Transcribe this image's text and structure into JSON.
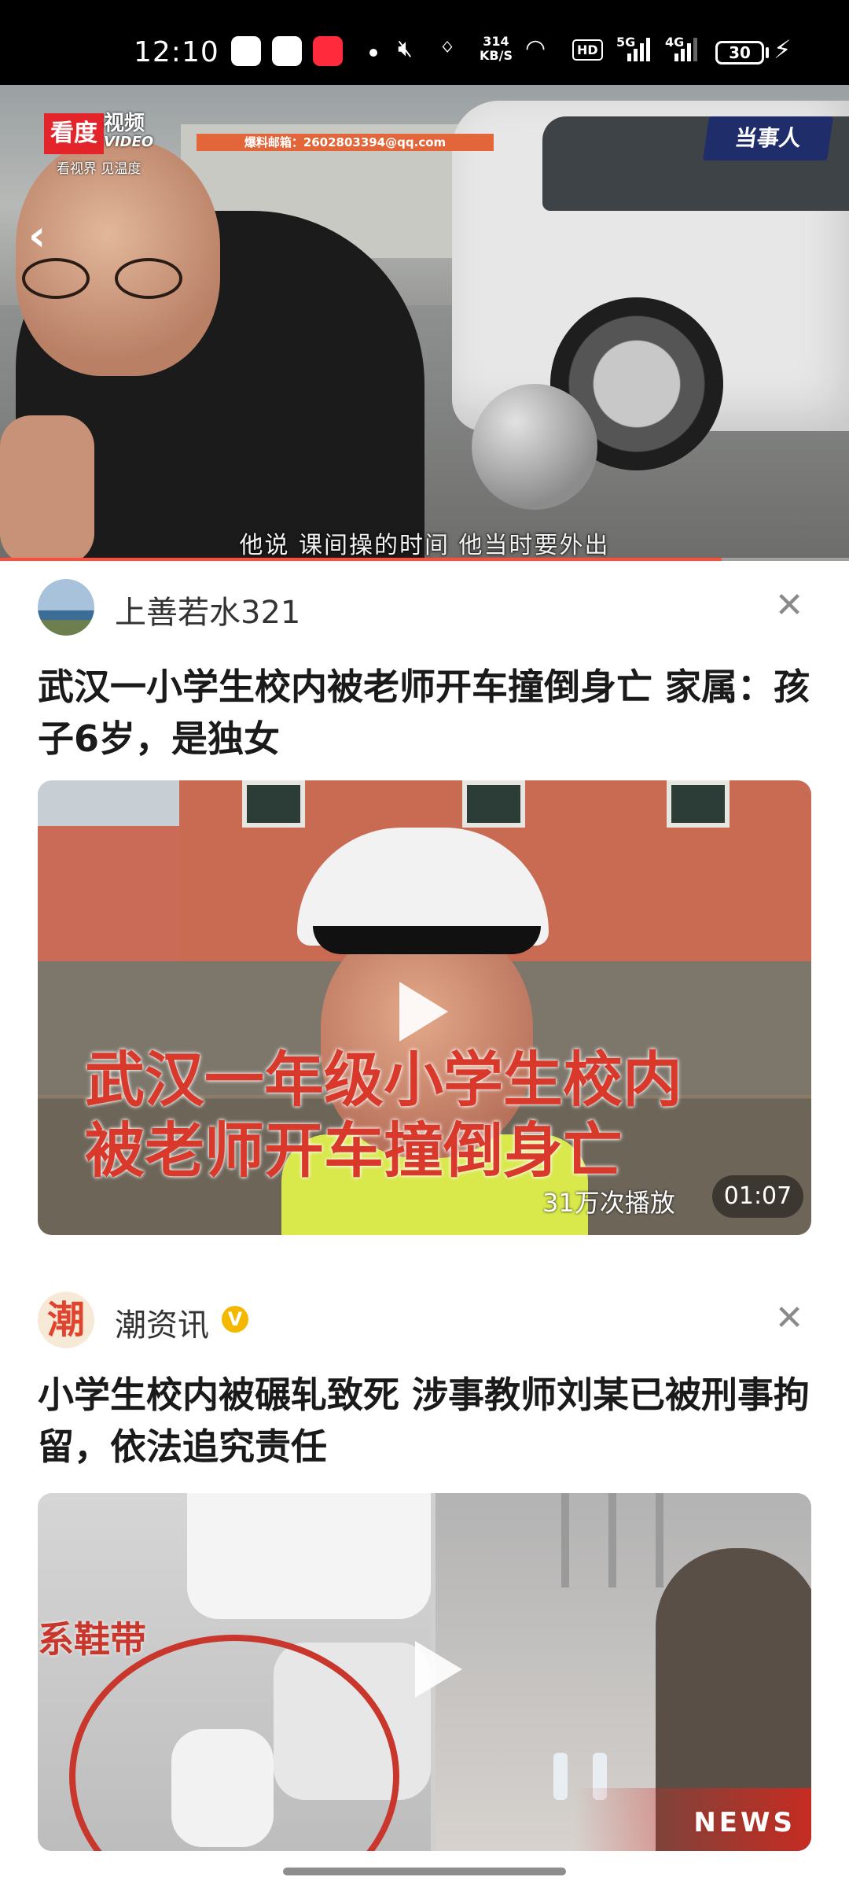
{
  "status_bar": {
    "time": "12:10",
    "net_speed_value": "314",
    "net_speed_unit": "KB/S",
    "hd": "HD",
    "sim1": "5G",
    "sim2": "4G",
    "battery": "30",
    "icons": [
      "game-app-icon",
      "browser-app-icon",
      "video-app-icon",
      "mute-icon",
      "bluetooth-icon",
      "wifi-icon",
      "signal-icon",
      "battery-icon",
      "charging-icon"
    ]
  },
  "player": {
    "logo_red": "看度",
    "logo_word": "视频",
    "logo_en": "VIDEO",
    "logo_slogan": "看视界 见温度",
    "email_banner": "爆料邮箱：2602803394@qq.com",
    "brand": "当事人",
    "subtitle": "他说   课间操的时间   他当时要外出",
    "progress_fraction": 0.85
  },
  "feed": [
    {
      "author": "上善若水321",
      "verified": false,
      "title": "武汉一小学生校内被老师开车撞倒身亡  家属：孩子6岁，是独女",
      "video_caption_line1": "武汉一年级小学生校内",
      "video_caption_line2": "被老师开车撞倒身亡",
      "plays": "31万次播放",
      "duration": "01:07"
    },
    {
      "author": "潮资讯",
      "avatar_char": "潮",
      "verified": true,
      "verified_mark": "V",
      "title": "小学生校内被碾轧致死 涉事教师刘某已被刑事拘留，依法追究责任",
      "image_label": "系鞋带",
      "image_badge": "NEWS"
    }
  ],
  "colors": {
    "accent_red": "#e3242b",
    "progress": "#ff4c3b",
    "verified": "#f5b800"
  }
}
